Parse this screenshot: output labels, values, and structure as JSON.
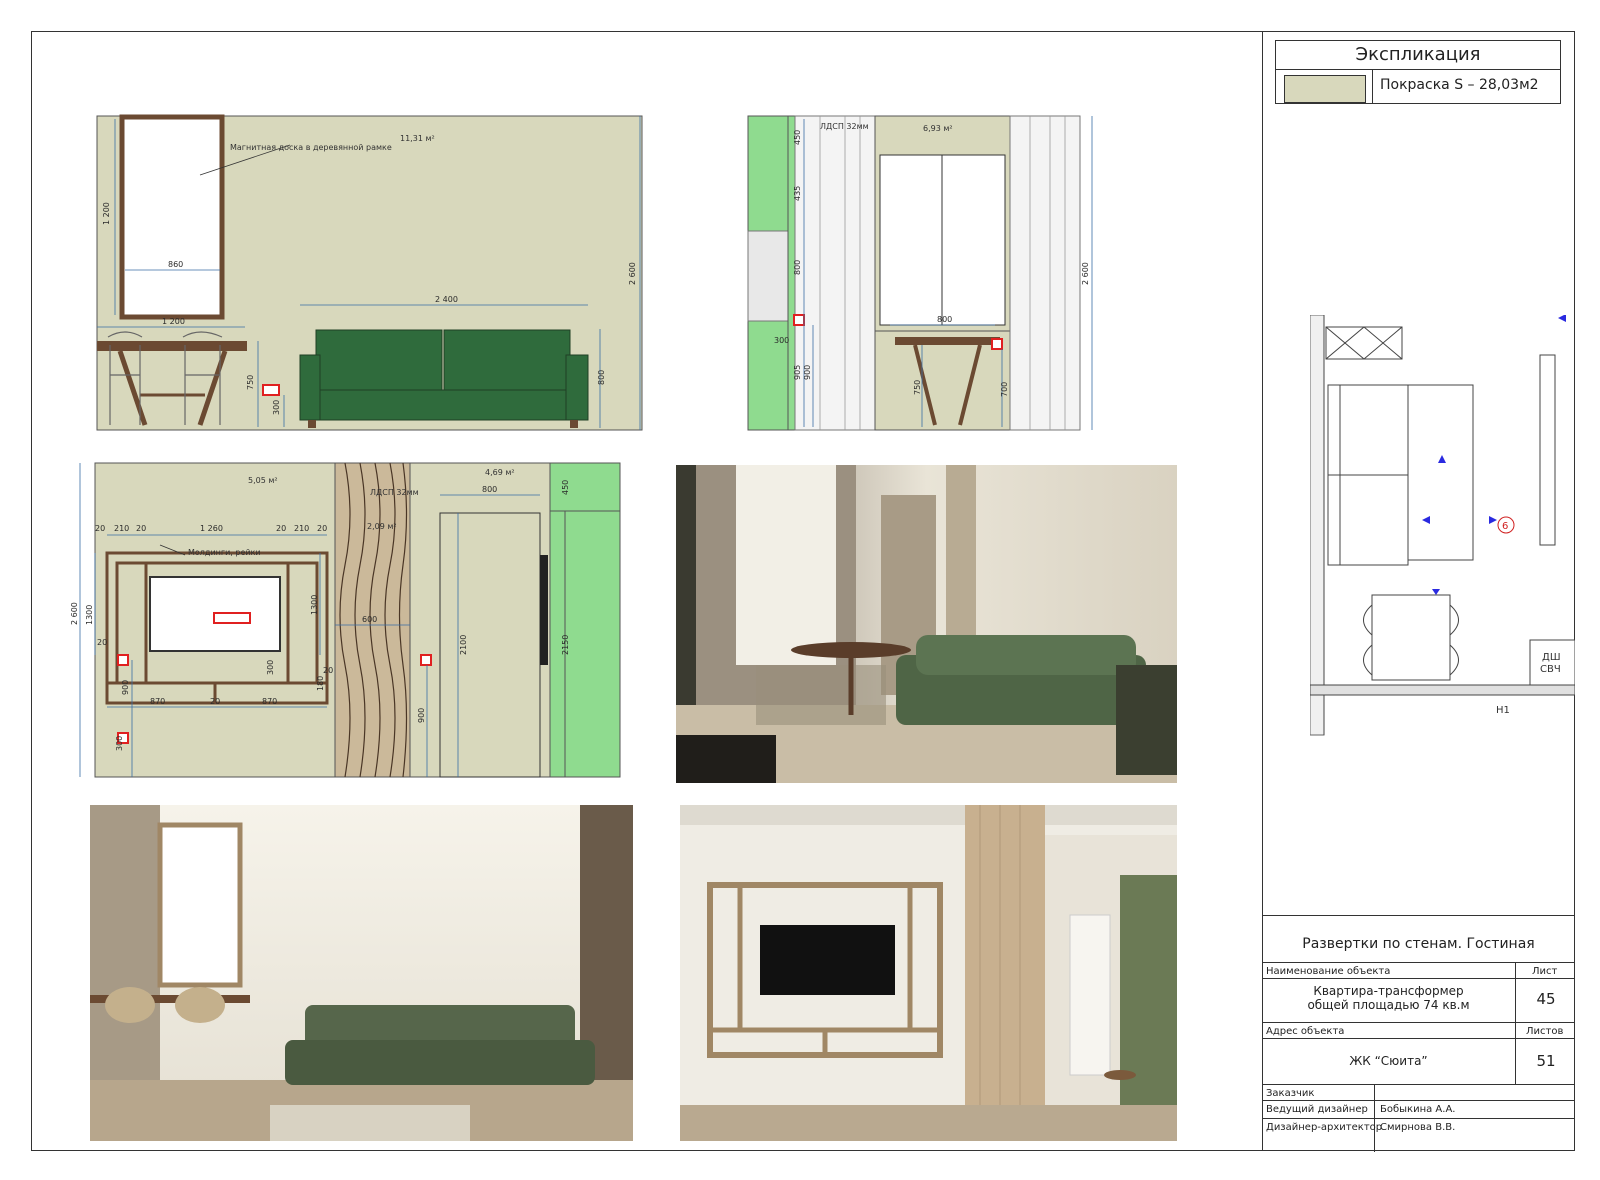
{
  "legend": {
    "title": "Экспликация",
    "item_label": "Покраска S – 28,03м2",
    "swatch_color": "#d8d8bc"
  },
  "colors": {
    "wall": "#d8d8bc",
    "sofa": "#2f6b3c",
    "cabinet_green": "#8fdb8f",
    "wood": "#6b4a32",
    "dim_line": "#3a6ea5",
    "socket_red": "#e02020"
  },
  "elev1": {
    "area_label": "11,31 м²",
    "note": "Магнитная доска в деревянной рамке",
    "dims": {
      "board_height": "1 200",
      "board_width": "860",
      "table_width": "1 200",
      "sofa_width": "2 400",
      "wall_height": "2 600",
      "table_height": "750",
      "socket_height": "300",
      "sofa_height": "800"
    }
  },
  "elev2": {
    "area_label": "6,93 м²",
    "note": "ЛДСП 32мм",
    "dims": {
      "d1": "450",
      "d2": "435",
      "d3": "800",
      "d4": "300",
      "d5": "905",
      "d6": "900",
      "window_width": "800",
      "table_height": "750",
      "socket_height": "700",
      "wall_height": "2 600"
    }
  },
  "elev3": {
    "area_label": "5,05 м²",
    "area_label2": "4,69 м²",
    "note_panel": "ЛДСП 32мм",
    "note_molding": "Молдинги, рейки",
    "area_label3": "2,09 м²",
    "dims": {
      "top_a": "20",
      "top_b": "210",
      "top_c": "20",
      "top_center": "1 260",
      "top_d": "20",
      "top_e": "210",
      "top_f": "20",
      "wall_height": "2 600",
      "left_a": "1300",
      "left_b": "20",
      "left_c": "900",
      "right_a": "1300",
      "right_b": "300",
      "right_c": "180",
      "right_d": "20",
      "bottom_a": "870",
      "bottom_b": "20",
      "bottom_c": "870",
      "socket_left": "300",
      "wall_strip": "600",
      "door_width": "800",
      "door_height": "2100",
      "socket_right": "900",
      "top_cab": "450",
      "cab_height": "2150"
    }
  },
  "plan": {
    "label_dw": "ДШ",
    "label_mw": "СВЧ",
    "marker": "6",
    "axis_label": "Н1"
  },
  "title_block": {
    "sheet_title": "Развертки по стенам. Гостиная",
    "object_name_label": "Наименование объекта",
    "sheet_label": "Лист",
    "object_name_line1": "Квартира-трансформер",
    "object_name_line2": "общей площадью 74 кв.м",
    "sheet_number": "45",
    "address_label": "Адрес объекта",
    "sheets_label": "Листов",
    "address": "ЖК “Сюита”",
    "sheets_total": "51",
    "customer_label": "Заказчик",
    "lead_designer_label": "Ведущий дизайнер",
    "lead_designer": "Бобыкина А.А.",
    "architect_label": "Дизайнер-архитектор",
    "architect": "Смирнова В.В."
  }
}
